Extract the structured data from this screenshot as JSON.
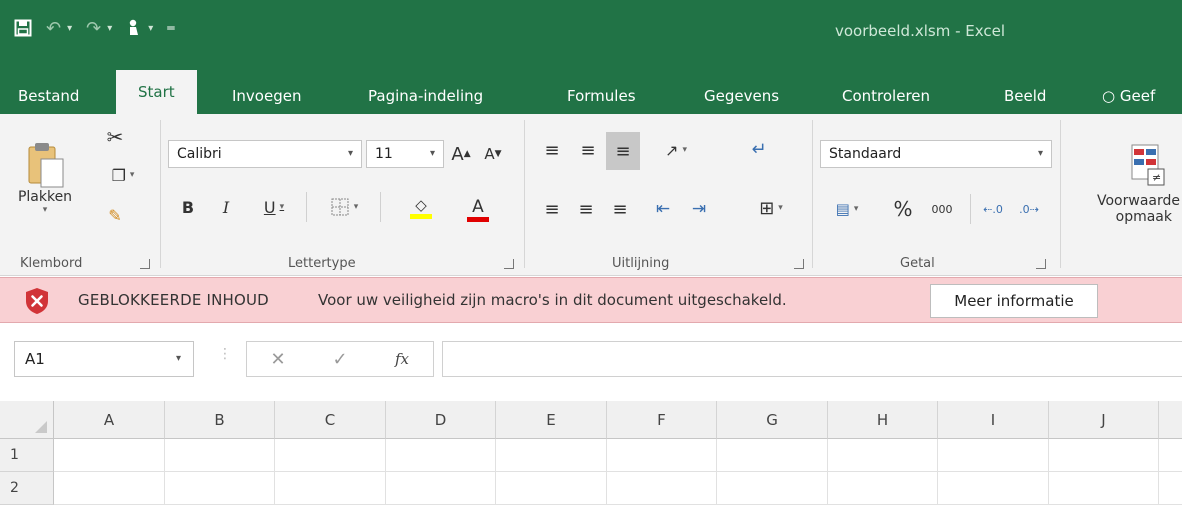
{
  "window": {
    "title": "voorbeeld.xlsm - Excel"
  },
  "quick_access": [
    "save-icon",
    "undo-icon",
    "redo-icon",
    "touch-mode-icon",
    "customize-qat-icon"
  ],
  "tabs": [
    {
      "label": "Bestand",
      "active": false
    },
    {
      "label": "Start",
      "active": true
    },
    {
      "label": "Invoegen",
      "active": false
    },
    {
      "label": "Pagina-indeling",
      "active": false
    },
    {
      "label": "Formules",
      "active": false
    },
    {
      "label": "Gegevens",
      "active": false
    },
    {
      "label": "Controleren",
      "active": false
    },
    {
      "label": "Beeld",
      "active": false
    }
  ],
  "tell_me": {
    "label": "Geef"
  },
  "ribbon": {
    "clipboard": {
      "paste_label": "Plakken",
      "group_label": "Klembord"
    },
    "font": {
      "name": "Calibri",
      "size": "11",
      "group_label": "Lettertype",
      "bold": "B",
      "italic": "I",
      "underline": "U",
      "grow": "A",
      "shrink": "A"
    },
    "alignment": {
      "group_label": "Uitlijning"
    },
    "number": {
      "format": "Standaard",
      "percent": "%",
      "thousands": "000",
      "group_label": "Getal"
    },
    "styles": {
      "label_line1": "Voorwaarde",
      "label_line2": "opmaak"
    }
  },
  "message_bar": {
    "title": "GEBLOKKEERDE INHOUD",
    "text": "Voor uw veiligheid zijn macro's in dit document uitgeschakeld.",
    "button": "Meer informatie",
    "accent": "#d13438"
  },
  "formula_bar": {
    "name_box": "A1",
    "fx": "fx",
    "value": ""
  },
  "grid": {
    "columns": [
      "A",
      "B",
      "C",
      "D",
      "E",
      "F",
      "G",
      "H",
      "I",
      "J"
    ],
    "rows": [
      "1",
      "2"
    ]
  },
  "colors": {
    "brand": "#217346",
    "ribbon_bg": "#f3f3f3",
    "message_bg": "#f9d0d3"
  }
}
